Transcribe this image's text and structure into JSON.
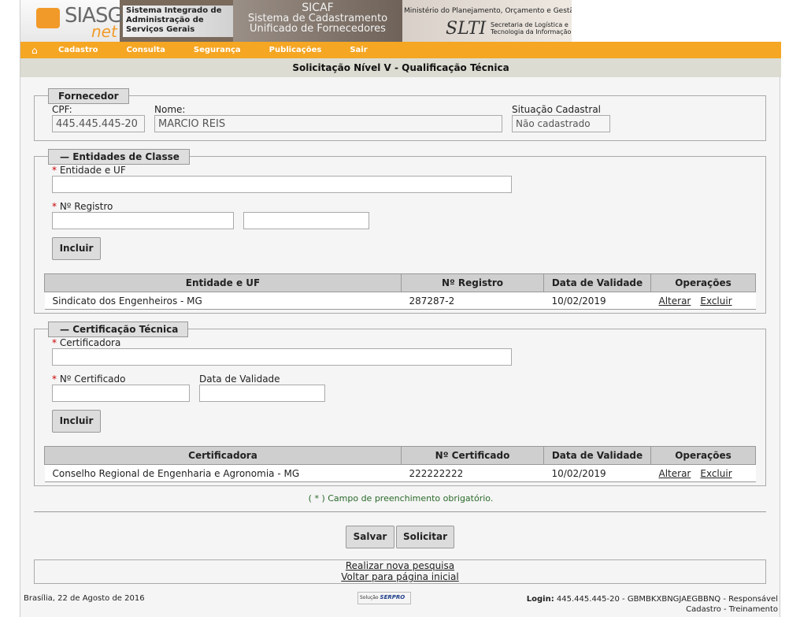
{
  "header": {
    "logo_text": "SIASG",
    "logo_suffix": "net",
    "system_name": "Sistema Integrado de Administração de Serviços Gerais",
    "sicaf_title": "SICAF",
    "sicaf_line1": "Sistema de Cadastramento",
    "sicaf_line2": "Unificado de Fornecedores",
    "ministry": "Ministério do Planejamento, Orçamento e Gestão",
    "slti": "SLTI",
    "secretaria": "Secretaria de Logística e Tecnologia da Informação"
  },
  "nav": {
    "items": [
      "Cadastro",
      "Consulta",
      "Segurança",
      "Publicações",
      "Sair"
    ]
  },
  "page_title": "Solicitação Nível V - Qualificação Técnica",
  "fornecedor": {
    "legend": "Fornecedor",
    "cpf_label": "CPF:",
    "cpf_value": "445.445.445-20",
    "nome_label": "Nome:",
    "nome_value": "MARCIO REIS",
    "situacao_label": "Situação Cadastral",
    "situacao_value": "Não cadastrado"
  },
  "entidades": {
    "legend": "Entidades de Classe",
    "entidade_label": "Entidade e UF",
    "registro_label": "Nº Registro",
    "incluir_label": "Incluir",
    "columns": [
      "Entidade e UF",
      "Nº Registro",
      "Data de Validade",
      "Operações"
    ],
    "rows": [
      {
        "entidade": "Sindicato dos Engenheiros - MG",
        "registro": "287287-2",
        "validade": "10/02/2019",
        "alterar": "Alterar",
        "excluir": "Excluir"
      }
    ]
  },
  "certificacao": {
    "legend": "Certificação Técnica",
    "certificadora_label": "Certificadora",
    "certificado_label": "Nº Certificado",
    "validade_label": "Data de Validade",
    "incluir_label": "Incluir",
    "columns": [
      "Certificadora",
      "Nº Certificado",
      "Data de Validade",
      "Operações"
    ],
    "rows": [
      {
        "certificadora": "Conselho Regional de Engenharia e Agronomia - MG",
        "certificado": "222222222",
        "validade": "10/02/2019",
        "alterar": "Alterar",
        "excluir": "Excluir"
      }
    ]
  },
  "required_marker": "*",
  "required_note": "( * ) Campo de preenchimento obrigatório.",
  "actions": {
    "salvar": "Salvar",
    "solicitar": "Solicitar"
  },
  "links": {
    "nova_pesquisa": "Realizar nova pesquisa",
    "voltar": "Voltar para página inicial"
  },
  "status": {
    "location_date": "Brasília, 22 de Agosto de 2016",
    "serpro_prefix": "Solução",
    "serpro": "SERPRO",
    "login_label": "Login:",
    "login_value": "445.445.445-20 - GBMBKXBNGJAEGBBNQ - Responsável",
    "login_line2": "Cadastro - Treinamento"
  },
  "colors": {
    "nav": "#f5a623",
    "titlebar": "#dcdcd2",
    "required": "#cc0000",
    "note": "#2a6a2a"
  }
}
